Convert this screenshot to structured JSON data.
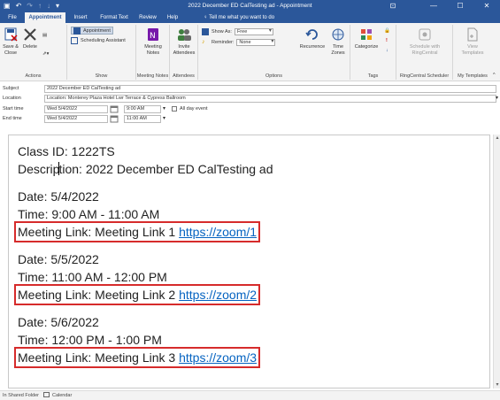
{
  "titlebar": {
    "title": "2022 December ED CalTesting ad  -  Appointment",
    "minimize": "—",
    "restore": "☐",
    "close": "✕"
  },
  "tabs": [
    {
      "label": "File"
    },
    {
      "label": "Appointment"
    },
    {
      "label": "Insert"
    },
    {
      "label": "Format Text"
    },
    {
      "label": "Review"
    },
    {
      "label": "Help"
    }
  ],
  "tellme": "Tell me what you want to do",
  "ribbon": {
    "actions": {
      "save_close": "Save & Close",
      "delete": "Delete",
      "group": "Actions"
    },
    "show": {
      "appointment": "Appointment",
      "scheduling": "Scheduling Assistant",
      "group": "Show"
    },
    "meeting_notes": {
      "label1": "Meeting",
      "label2": "Notes",
      "group": "Meeting Notes"
    },
    "attendees": {
      "label1": "Invite",
      "label2": "Attendees",
      "group": "Attendees"
    },
    "options": {
      "show_as_label": "Show As:",
      "show_as_value": "Free",
      "reminder_label": "Reminder:",
      "reminder_value": "None",
      "recurrence": "Recurrence",
      "time_zones1": "Time",
      "time_zones2": "Zones",
      "group": "Options"
    },
    "tags": {
      "categorize": "Categorize",
      "group": "Tags"
    },
    "ringcentral": {
      "label1": "Schedule with",
      "label2": "RingCentral",
      "group": "RingCentral Scheduler"
    },
    "templates": {
      "label1": "View",
      "label2": "Templates",
      "group": "My Templates"
    }
  },
  "form": {
    "subject_label": "Subject",
    "subject_value": "2022 December ED CalTesting ad",
    "location_label": "Location",
    "location_value": "Location: Monterey Plaza Hotel Lwr Terrace & Cypress Ballroom",
    "start_label": "Start time",
    "start_date": "Wed 5/4/2022",
    "start_time": "9:00 AM",
    "all_day": "All day event",
    "end_label": "End time",
    "end_date": "Wed 5/4/2022",
    "end_time": "11:00 AM"
  },
  "body": {
    "class_id": "Class ID: 1222TS",
    "description_a": "Descrip",
    "description_b": "tion: 2022 December ED CalTesting ad",
    "sessions": [
      {
        "date": "Date: 5/4/2022",
        "time": "Time: 9:00 AM - 11:00 AM",
        "link_label": "Meeting Link: Meeting Link 1",
        "link_url": "https://zoom/1"
      },
      {
        "date": "Date: 5/5/2022",
        "time": "Time: 11:00 AM - 12:00 PM",
        "link_label": "Meeting Link: Meeting Link 2",
        "link_url": "https://zoom/2"
      },
      {
        "date": "Date: 5/6/2022",
        "time": "Time: 12:00 PM - 1:00 PM",
        "link_label": "Meeting Link: Meeting Link 3",
        "link_url": "https://zoom/3"
      }
    ]
  },
  "status": {
    "folder": "In Shared Folder",
    "calendar": "Calendar"
  },
  "colors": {
    "accent": "#2b579a",
    "highlight_box": "#d62b2b",
    "link": "#0563c1"
  }
}
